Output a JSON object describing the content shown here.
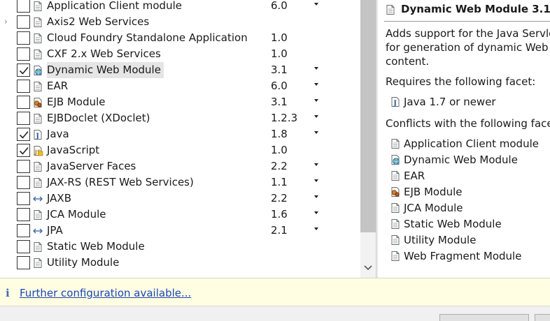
{
  "facets": [
    {
      "name": "Application Client module",
      "version": "6.0",
      "checked": false,
      "has_dropdown": true,
      "icon": "page-icon",
      "expander": false,
      "selected": false
    },
    {
      "name": "Axis2 Web Services",
      "version": "",
      "checked": false,
      "has_dropdown": false,
      "icon": "page-icon",
      "expander": true,
      "selected": false
    },
    {
      "name": "Cloud Foundry Standalone Application",
      "version": "1.0",
      "checked": false,
      "has_dropdown": false,
      "icon": "page-icon",
      "expander": false,
      "selected": false
    },
    {
      "name": "CXF 2.x Web Services",
      "version": "1.0",
      "checked": false,
      "has_dropdown": false,
      "icon": "page-icon",
      "expander": false,
      "selected": false
    },
    {
      "name": "Dynamic Web Module",
      "version": "3.1",
      "checked": true,
      "has_dropdown": true,
      "icon": "web-module-icon",
      "expander": false,
      "selected": true
    },
    {
      "name": "EAR",
      "version": "6.0",
      "checked": false,
      "has_dropdown": true,
      "icon": "page-icon",
      "expander": false,
      "selected": false
    },
    {
      "name": "EJB Module",
      "version": "3.1",
      "checked": false,
      "has_dropdown": true,
      "icon": "ejb-icon",
      "expander": false,
      "selected": false
    },
    {
      "name": "EJBDoclet (XDoclet)",
      "version": "1.2.3",
      "checked": false,
      "has_dropdown": true,
      "icon": "page-icon",
      "expander": false,
      "selected": false
    },
    {
      "name": "Java",
      "version": "1.8",
      "checked": true,
      "has_dropdown": true,
      "icon": "java-icon",
      "expander": false,
      "selected": false
    },
    {
      "name": "JavaScript",
      "version": "1.0",
      "checked": true,
      "has_dropdown": false,
      "icon": "javascript-icon",
      "expander": false,
      "selected": false
    },
    {
      "name": "JavaServer Faces",
      "version": "2.2",
      "checked": false,
      "has_dropdown": true,
      "icon": "page-icon",
      "expander": false,
      "selected": false
    },
    {
      "name": "JAX-RS (REST Web Services)",
      "version": "1.1",
      "checked": false,
      "has_dropdown": true,
      "icon": "page-icon",
      "expander": false,
      "selected": false
    },
    {
      "name": "JAXB",
      "version": "2.2",
      "checked": false,
      "has_dropdown": true,
      "icon": "arrows-icon",
      "expander": false,
      "selected": false
    },
    {
      "name": "JCA Module",
      "version": "1.6",
      "checked": false,
      "has_dropdown": true,
      "icon": "page-icon",
      "expander": false,
      "selected": false
    },
    {
      "name": "JPA",
      "version": "2.1",
      "checked": false,
      "has_dropdown": true,
      "icon": "arrows-icon",
      "expander": false,
      "selected": false
    },
    {
      "name": "Static Web Module",
      "version": "",
      "checked": false,
      "has_dropdown": false,
      "icon": "page-icon",
      "expander": false,
      "selected": false
    },
    {
      "name": "Utility Module",
      "version": "",
      "checked": false,
      "has_dropdown": false,
      "icon": "page-icon",
      "expander": false,
      "selected": false
    }
  ],
  "details": {
    "title": "Dynamic Web Module 3.1",
    "description_lines": [
      "Adds support for the Java Servlet API,",
      "for generation of dynamic Web page",
      "content."
    ],
    "requires_label": "Requires the following facet:",
    "requires": [
      {
        "name": "Java 1.7 or newer",
        "icon": "java-icon"
      }
    ],
    "conflicts_label": "Conflicts with the following facets:",
    "conflicts": [
      {
        "name": "Application Client module",
        "icon": "page-icon"
      },
      {
        "name": "Dynamic Web Module",
        "icon": "web-module-icon"
      },
      {
        "name": "EAR",
        "icon": "page-icon"
      },
      {
        "name": "EJB Module",
        "icon": "ejb-icon"
      },
      {
        "name": "JCA Module",
        "icon": "page-icon"
      },
      {
        "name": "Static Web Module",
        "icon": "page-icon"
      },
      {
        "name": "Utility Module",
        "icon": "page-icon"
      },
      {
        "name": "Web Fragment Module",
        "icon": "page-icon"
      }
    ]
  },
  "info_bar": {
    "icon": "info-icon",
    "link": "Further configuration available..."
  },
  "colors": {
    "link": "#1a44b8",
    "info_background": "#fffee3",
    "selection": "#e5e5e5"
  }
}
